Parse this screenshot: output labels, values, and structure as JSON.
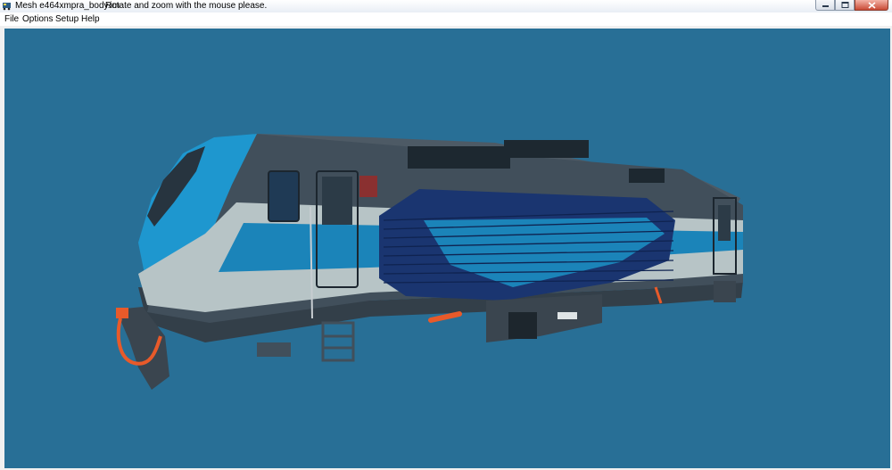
{
  "window": {
    "title": "Mesh e464xmpra_body.im",
    "hint": "Rotate and zoom with the mouse please.",
    "buttons": {
      "minimize": "minimize-icon",
      "maximize": "maximize-icon",
      "close": "close-icon"
    }
  },
  "menu": [
    {
      "label": "File"
    },
    {
      "label": "Options"
    },
    {
      "label": "Setup"
    },
    {
      "label": "Help"
    }
  ],
  "viewport": {
    "background": "#286f96",
    "model": "locomotive-body-mesh"
  },
  "colors": {
    "body_dark": "#414f5b",
    "stripe_light": "#b7c4c6",
    "accent_blue": "#1b84b9",
    "accent_cyan": "#1e97cf",
    "navy": "#1a3570",
    "orange": "#e85a2a"
  }
}
